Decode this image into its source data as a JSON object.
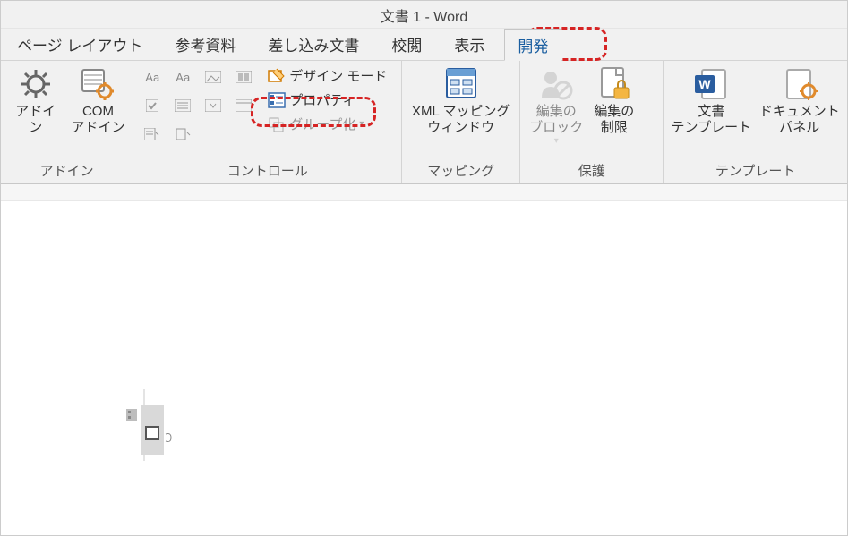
{
  "title": "文書 1 - Word",
  "tabs": {
    "page_layout": "ページ レイアウト",
    "references": "参考資料",
    "mailings": "差し込み文書",
    "review": "校閲",
    "view": "表示",
    "developer": "開発"
  },
  "groups": {
    "addins": {
      "label": "アドイン",
      "addin": "アドイン",
      "com_addin": "COM\nアドイン"
    },
    "controls": {
      "label": "コントロール",
      "design_mode": "デザイン モード",
      "properties": "プロパティ",
      "group": "グループ化"
    },
    "mapping": {
      "label": "マッピング",
      "xml_mapping": "XML マッピング\nウィンドウ"
    },
    "protect": {
      "label": "保護",
      "block": "編集の\nブロック",
      "restrict": "編集の\n制限"
    },
    "template": {
      "label": "テンプレート",
      "doc_template": "文書\nテンプレート",
      "doc_panel": "ドキュメント\nパネル"
    }
  }
}
